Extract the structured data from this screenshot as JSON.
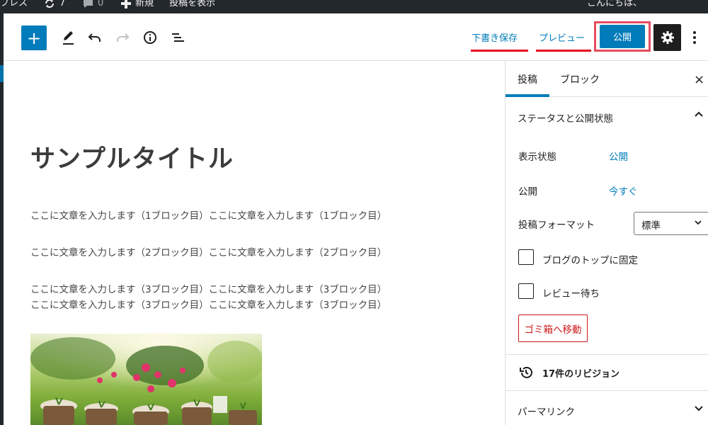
{
  "admin_bar": {
    "site_label": "プレス",
    "updates_count": "7",
    "comments_count": "0",
    "new_label": "新規",
    "view_post_label": "投稿を表示",
    "greeting": "こんにちは、"
  },
  "toolbar": {
    "add_label": "+",
    "save_draft_label": "下書き保存",
    "preview_label": "プレビュー",
    "publish_label": "公開"
  },
  "content": {
    "title": "サンプルタイトル",
    "paragraphs": [
      "ここに文章を入力します（1ブロック目）ここに文章を入力します（1ブロック目）",
      "ここに文章を入力します（2ブロック目）ここに文章を入力します（2ブロック目）",
      "ここに文章を入力します（3ブロック目）ここに文章を入力します（3ブロック目）",
      "ここに文章を入力します（3ブロック目）ここに文章を入力します（3ブロック目）"
    ]
  },
  "sidebar": {
    "tabs": [
      {
        "label": "投稿"
      },
      {
        "label": "ブロック"
      }
    ],
    "close_label": "×",
    "status_panel": {
      "title": "ステータスと公開状態",
      "visibility_label": "表示状態",
      "visibility_value": "公開",
      "publish_label": "公開",
      "publish_value": "今すぐ",
      "format_label": "投稿フォーマット",
      "format_value": "標準",
      "sticky_label": "ブログのトップに固定",
      "review_label": "レビュー待ち",
      "trash_label": "ゴミ箱へ移動"
    },
    "revisions_label": "17件のリビジョン",
    "permalink_label": "パーマリンク"
  },
  "colors": {
    "accent": "#007cba",
    "admin_bar": "#23282d",
    "highlight_red": "#e6001f",
    "trash_red": "#cc1818"
  }
}
